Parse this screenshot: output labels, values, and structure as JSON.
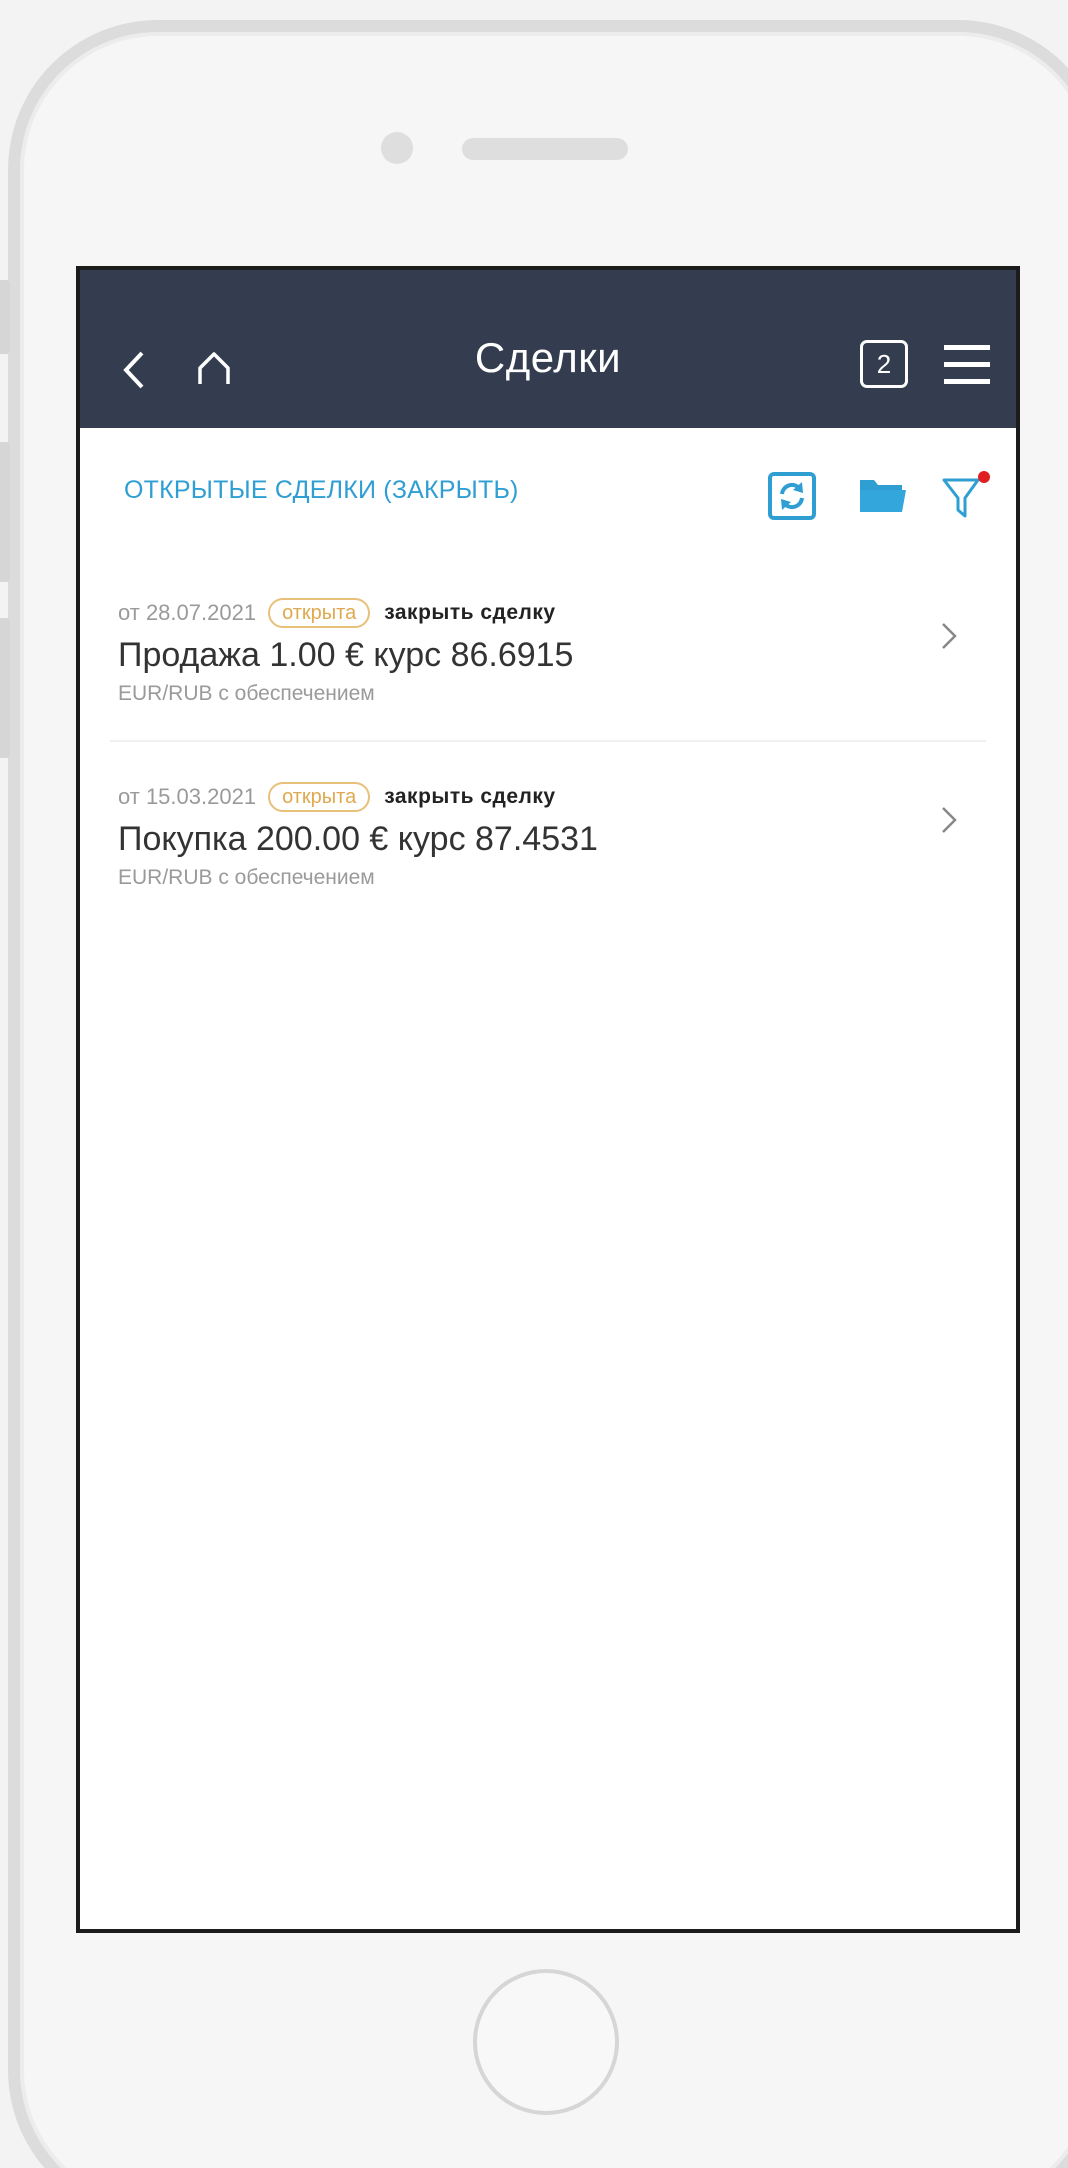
{
  "header": {
    "title": "Сделки",
    "tasks_count": "2",
    "bg_color": "#333d4f"
  },
  "toolbar": {
    "open_deals_link": "ОТКРЫТЫЕ СДЕЛКИ (ЗАКРЫТЬ)",
    "icons": [
      "refresh-icon",
      "folder-icon",
      "filter-icon"
    ],
    "accent_color": "#2f9fd3"
  },
  "deals": [
    {
      "date": "от 28.07.2021",
      "status": "открыта",
      "close_label": "закрыть сделку",
      "title": "Продажа 1.00 € курс 86.6915",
      "subtitle": "EUR/RUB  с обеспечением"
    },
    {
      "date": "от 15.03.2021",
      "status": "открыта",
      "close_label": "закрыть сделку",
      "title": "Покупка 200.00 € курс 87.4531",
      "subtitle": "EUR/RUB  с обеспечением"
    }
  ]
}
